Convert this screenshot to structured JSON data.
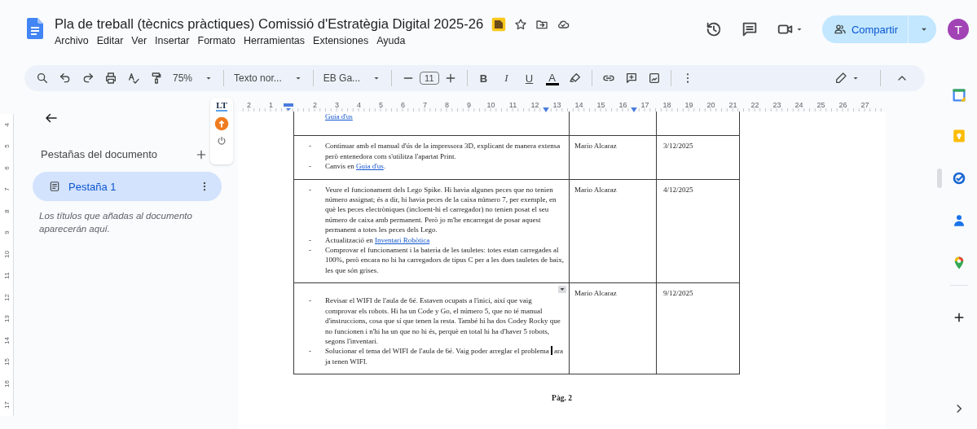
{
  "document": {
    "title": "Pla de treball (tècnics pràctiques) Comissió d'Estratègia Digital 2025-26"
  },
  "menu": [
    "Archivo",
    "Editar",
    "Ver",
    "Insertar",
    "Formato",
    "Herramientas",
    "Extensiones",
    "Ayuda"
  ],
  "share_button": {
    "label": "Compartir"
  },
  "avatar": {
    "initial": "T"
  },
  "toolbar": {
    "zoom": "75%",
    "style": "Texto nor...",
    "font": "EB Ga...",
    "font_size": "11",
    "format": [
      {
        "kind": "bold",
        "label": "B"
      },
      {
        "kind": "italic",
        "label": "I"
      },
      {
        "kind": "underline",
        "label": "U"
      },
      {
        "kind": "color",
        "label": "A"
      }
    ]
  },
  "ruler": {
    "horizontal": [
      "2",
      "1",
      "2",
      "3",
      "4",
      "5",
      "6",
      "7",
      "8",
      "9",
      "10",
      "11",
      "12",
      "13",
      "14",
      "15",
      "16",
      "17",
      "18",
      "19",
      "20",
      "21",
      "22",
      "23",
      "24",
      "25",
      "26",
      "27"
    ],
    "vertical": [
      "4",
      "5",
      "6",
      "7",
      "8",
      "9",
      "10",
      "11",
      "12",
      "13",
      "14",
      "15",
      "16",
      "17"
    ]
  },
  "sidebar": {
    "heading": "Pestañas del documento",
    "tabs": [
      {
        "label": "Pestaña 1",
        "selected": true
      }
    ],
    "hint": "Los títulos que añadas al documento aparecerán aquí."
  },
  "language_tool": {
    "label": "LT"
  },
  "table": {
    "rows": [
      {
        "items": [
          {
            "parts": [
              {
                "kind": "link",
                "text": "Guia d'us"
              }
            ]
          }
        ]
      },
      {
        "name": "Mario Alcaraz",
        "date": "3/12/2025",
        "items": [
          {
            "marker": "-",
            "parts": [
              {
                "kind": "text",
                "text": "Continuar amb el manual d'ús de la impressora 3D, explicant de manera extensa però entenedora com s'utilitza l'apartat Print."
              }
            ]
          },
          {
            "marker": "-",
            "parts": [
              {
                "kind": "text",
                "text": "Canvis en "
              },
              {
                "kind": "link",
                "text": "Guia d'us"
              },
              {
                "kind": "text",
                "text": "."
              }
            ]
          }
        ]
      },
      {
        "name": "Mario Alcaraz",
        "date": "4/12/2025",
        "items": [
          {
            "marker": "-",
            "parts": [
              {
                "kind": "text",
                "text": "Veure el funcionament dels Lego Spike. Hi havia algunes peces que no tenien número assignat; és a dir, hi havia peces de la caixa número 7, per exemple, en què les peces electròniques (incloent-hi el carregador) no tenien posat el seu número de caixa amb permanent. Però jo m'he encarregat de posar aquest permanent a totes les peces dels Lego."
              }
            ]
          },
          {
            "marker": "-",
            "parts": [
              {
                "kind": "text",
                "text": "Actualització en "
              },
              {
                "kind": "link",
                "text": "Inventari Robòtica"
              }
            ]
          },
          {
            "marker": "-",
            "parts": [
              {
                "kind": "text",
                "text": "Comprovar el funcionament i la bateria de les tauletes: totes estan carregades al 100%, però encara no hi ha carregadors de tipus C per a les dues tauletes de baix, les que són grises."
              }
            ]
          }
        ]
      },
      {
        "name": "Mario Alcaraz",
        "date": "9/12/2025",
        "cell_menu": true,
        "items": [
          {
            "marker": "-",
            "parts": [
              {
                "kind": "text",
                "text": "Revisar el WIFI de l'aula de 6é. Estaven ocupats a l'inici, així que vaig comprovar els robots. Hi ha un Code y Go, el número 5, que no té manual d'instruccions, cosa que sí que tenen la resta. També hi ha dos Codey Rocky que no funcionen i n'hi ha un que no hi és, perquè en total hi ha d'haver 5 robots, segons l'inventari."
              }
            ]
          },
          {
            "marker": "-",
            "parts": [
              {
                "kind": "text",
                "text": "Solucionar el tema del WIFI de l'aula de 6é. Vaig poder arreglar el problema "
              },
              {
                "kind": "cursor"
              },
              {
                "kind": "text",
                "text": "ara ja tenen WIFI."
              }
            ]
          }
        ]
      }
    ]
  },
  "page_number": "Pàg. 2"
}
